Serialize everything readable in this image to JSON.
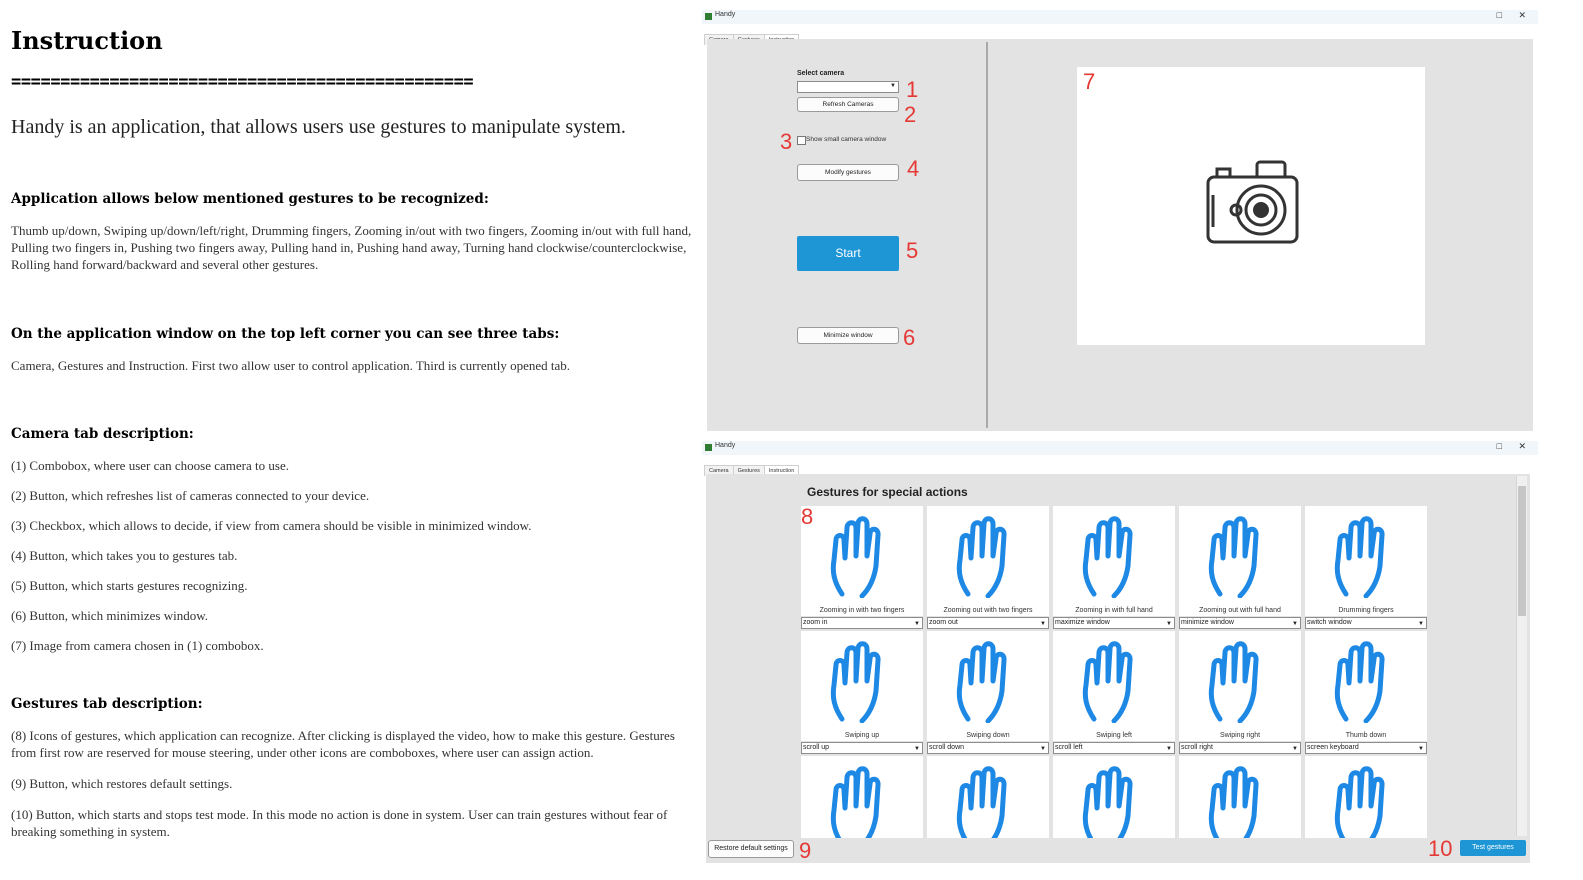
{
  "doc": {
    "title": "Instruction",
    "rule": "===============================================",
    "intro": "Handy is an application, that allows users use gestures to manipulate system.",
    "sections": [
      {
        "heading": "Application allows below mentioned gestures to be recognized:",
        "paragraphs": [
          "Thumb up/down, Swiping up/down/left/right, Drumming fingers, Zooming in/out with two fingers, Zooming in/out with full hand, Pulling two fingers in, Pushing two fingers away, Pulling hand in, Pushing hand away, Turning hand clockwise/counterclockwise, Rolling hand forward/backward and several other gestures."
        ]
      },
      {
        "heading": "On the application window on the top left corner you can see three tabs:",
        "paragraphs": [
          "Camera, Gestures and Instruction. First two allow user to control application. Third is currently opened tab."
        ]
      },
      {
        "heading": "Camera tab description:",
        "paragraphs": [
          "(1) Combobox, where user can choose camera to use.",
          "(2) Button, which refreshes list of cameras connected to your device.",
          "(3) Checkbox, which allows to decide, if view from camera should be visible in minimized window.",
          "(4) Button, which takes you to gestures tab.",
          "(5) Button, which starts gestures recognizing.",
          "(6) Button, which minimizes window.",
          "(7) Image from camera chosen in (1) combobox."
        ]
      },
      {
        "heading": "Gestures tab description:",
        "paragraphs": [
          "(8) Icons of gestures, which application can recognize. After clicking is displayed the video, how to make this gesture. Gestures from first row are reserved for mouse steering, under other icons are comboboxes, where user can assign action.",
          "(9) Button, which restores default settings.",
          "(10) Button, which starts and stops test mode. In this mode no action is done in system. User can train gestures without fear of breaking something in system."
        ]
      }
    ]
  },
  "camera_window": {
    "title": "Handy",
    "tabs": [
      "Camera",
      "Gestures",
      "Instruction"
    ],
    "select_camera_label": "Select camera",
    "camera_combo_value": "",
    "refresh_label": "Refresh Cameras",
    "checkbox_label": "Show small camera window",
    "checkbox_checked": false,
    "modify_label": "Modify gestures",
    "start_label": "Start",
    "minimize_label": "Minimize window",
    "callouts": [
      "1",
      "2",
      "3",
      "4",
      "5",
      "6",
      "7"
    ],
    "camera_icon": "camera-icon",
    "accent": "#1e96d6"
  },
  "gestures_window": {
    "title": "Handy",
    "tabs": [
      "Camera",
      "Gestures",
      "Instruction"
    ],
    "heading": "Gestures for special actions",
    "icon_color": "#1e88e5",
    "rows": [
      [
        {
          "label": "Zooming in with two fingers",
          "action": "zoom in",
          "icon": "zoom-in-two-fingers-icon"
        },
        {
          "label": "Zooming out with two fingers",
          "action": "zoom out",
          "icon": "zoom-out-two-fingers-icon"
        },
        {
          "label": "Zooming in with full hand",
          "action": "maximize window",
          "icon": "zoom-in-full-hand-icon"
        },
        {
          "label": "Zooming out with full hand",
          "action": "minimize window",
          "icon": "zoom-out-full-hand-icon"
        },
        {
          "label": "Drumming fingers",
          "action": "switch window",
          "icon": "drumming-fingers-icon"
        }
      ],
      [
        {
          "label": "Swiping up",
          "action": "scroll up",
          "icon": "swipe-up-icon"
        },
        {
          "label": "Swiping down",
          "action": "scroll down",
          "icon": "swipe-down-icon"
        },
        {
          "label": "Swiping left",
          "action": "scroll left",
          "icon": "swipe-left-icon"
        },
        {
          "label": "Swiping right",
          "action": "scroll right",
          "icon": "swipe-right-icon"
        },
        {
          "label": "Thumb down",
          "action": "screen keyboard",
          "icon": "thumb-down-icon"
        }
      ],
      [
        {
          "icon": "pull-left-icon"
        },
        {
          "icon": "push-right-icon"
        },
        {
          "icon": "pull-up-icon"
        },
        {
          "icon": "push-down-icon"
        },
        {
          "icon": "open-hand-icon"
        }
      ]
    ],
    "restore_label": "Restore default settings",
    "test_label": "Test gestures",
    "callouts": [
      "8",
      "9",
      "10"
    ]
  }
}
